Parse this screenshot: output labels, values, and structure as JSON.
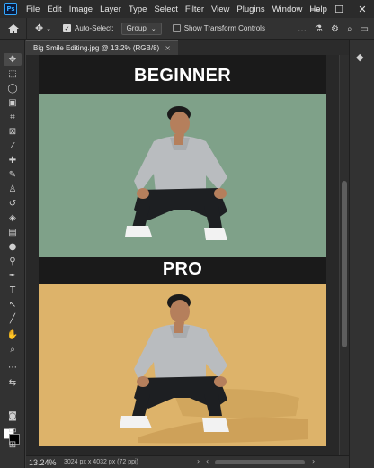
{
  "menubar": {
    "items": [
      "File",
      "Edit",
      "Image",
      "Layer",
      "Type",
      "Select",
      "Filter",
      "View",
      "Plugins",
      "Window",
      "Help"
    ],
    "logo": "Ps",
    "window_controls": [
      "—",
      "☐",
      "✕"
    ]
  },
  "options": {
    "auto_select_label": "Auto-Select:",
    "auto_select_checked": true,
    "target_value": "Group",
    "transform_label": "Show Transform Controls",
    "transform_checked": false
  },
  "document": {
    "tab_title": "Big Smile Editing.jpg @ 13.2% (RGB/8)",
    "close": "×",
    "heading_top": "BEGINNER",
    "heading_bottom": "PRO",
    "colors": {
      "beginner_bg": "#7fa189",
      "pro_bg": "#ddb36a",
      "canvas_bg": "#1a1a1a"
    }
  },
  "status": {
    "zoom": "13.24%",
    "doc_info": "3024 px x 4032 px (72 ppi)"
  },
  "icons": {
    "home": "home-icon",
    "move": "move-tool-icon",
    "panels": "panels-icon"
  }
}
